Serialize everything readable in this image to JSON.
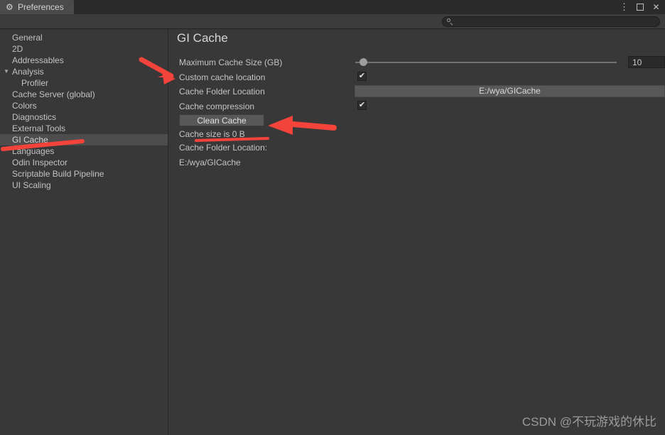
{
  "window": {
    "tab_label": "Preferences",
    "tab_icon": "gear-icon",
    "controls": {
      "kebab": "⋮",
      "maximize": "",
      "close": "✕"
    }
  },
  "toolbar": {
    "search_value": "",
    "search_placeholder": "",
    "search_icon": "search-icon"
  },
  "sidebar": {
    "items": [
      {
        "label": "General",
        "indent": false,
        "foldout": "",
        "selected": false
      },
      {
        "label": "2D",
        "indent": false,
        "foldout": "",
        "selected": false
      },
      {
        "label": "Addressables",
        "indent": false,
        "foldout": "",
        "selected": false
      },
      {
        "label": "Analysis",
        "indent": false,
        "foldout": "▼",
        "selected": false
      },
      {
        "label": "Profiler",
        "indent": true,
        "foldout": "",
        "selected": false
      },
      {
        "label": "Cache Server (global)",
        "indent": false,
        "foldout": "",
        "selected": false
      },
      {
        "label": "Colors",
        "indent": false,
        "foldout": "",
        "selected": false
      },
      {
        "label": "Diagnostics",
        "indent": false,
        "foldout": "",
        "selected": false
      },
      {
        "label": "External Tools",
        "indent": false,
        "foldout": "",
        "selected": false
      },
      {
        "label": "GI Cache",
        "indent": false,
        "foldout": "",
        "selected": true
      },
      {
        "label": "Languages",
        "indent": false,
        "foldout": "",
        "selected": false
      },
      {
        "label": "Odin Inspector",
        "indent": false,
        "foldout": "",
        "selected": false
      },
      {
        "label": "Scriptable Build Pipeline",
        "indent": false,
        "foldout": "",
        "selected": false
      },
      {
        "label": "UI Scaling",
        "indent": false,
        "foldout": "",
        "selected": false
      }
    ]
  },
  "main": {
    "title": "GI Cache",
    "max_cache_size": {
      "label": "Maximum Cache Size (GB)",
      "value": "10",
      "slider_percent": 3
    },
    "custom_cache_location": {
      "label": "Custom cache location",
      "checked": true,
      "check_glyph": "✔"
    },
    "cache_folder_location": {
      "label": "Cache Folder Location",
      "value": "E:/wya/GICache"
    },
    "cache_compression": {
      "label": "Cache compression",
      "checked": true,
      "check_glyph": "✔"
    },
    "clean_cache_button": "Clean Cache",
    "cache_size_info": "Cache size is 0 B",
    "cache_folder_label": "Cache Folder Location:",
    "cache_folder_path": "E:/wya/GICache"
  },
  "annotations": {
    "color": "#f3433a",
    "arrow_1_target": "Custom cache location",
    "arrow_2_target": "Clean Cache",
    "underline_1_target": "Languages",
    "underline_2_target": "Cache size is 0 B"
  },
  "watermark": "CSDN @不玩游戏的休比"
}
